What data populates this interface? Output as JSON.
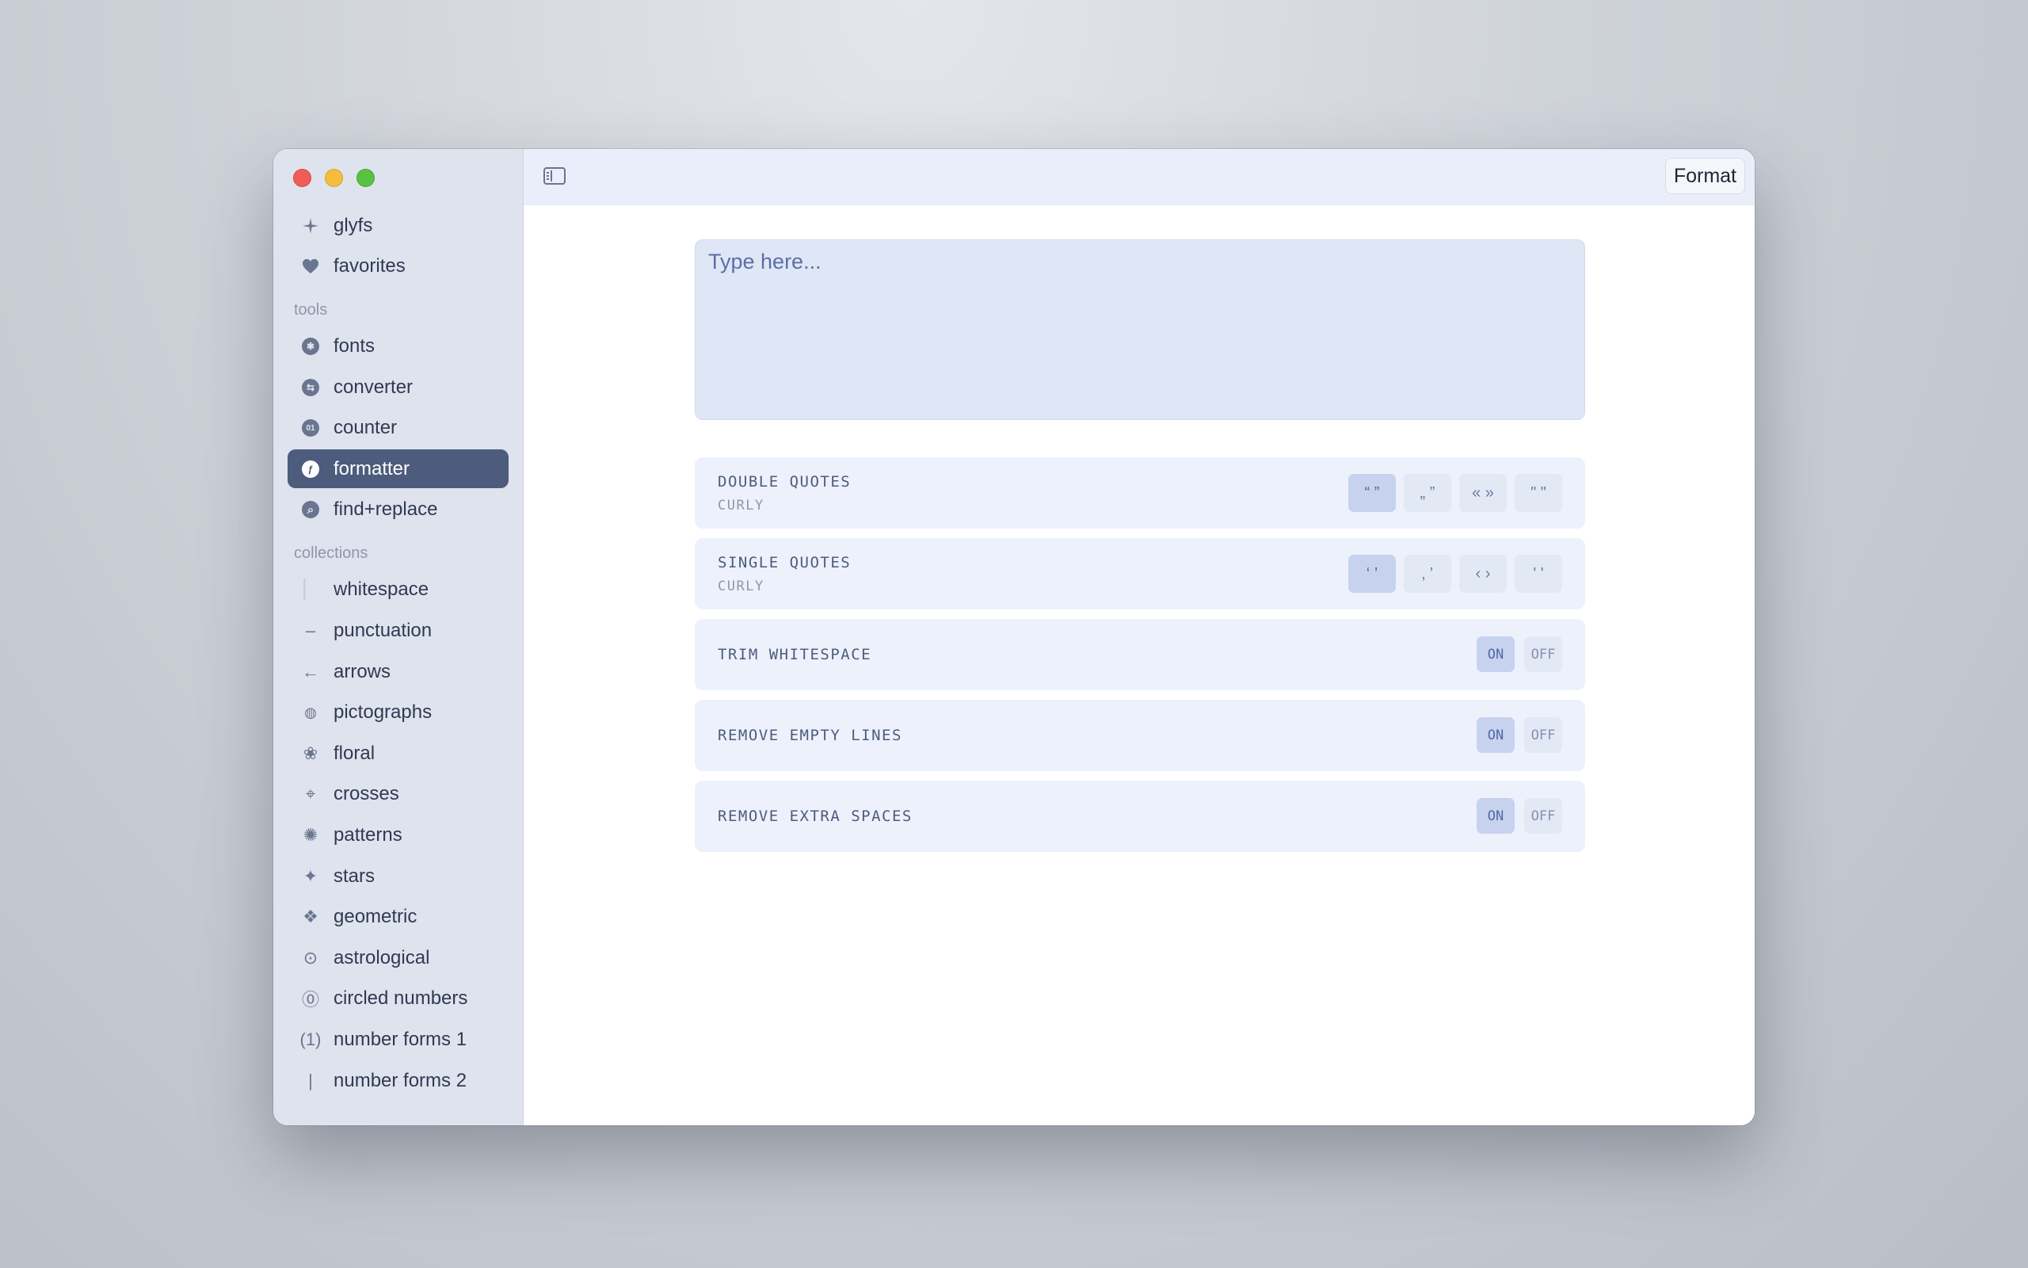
{
  "sidebar": {
    "top_items": [
      {
        "label": "glyfs",
        "icon": "sparkle-icon"
      },
      {
        "label": "favorites",
        "icon": "heart-icon"
      }
    ],
    "tools_label": "tools",
    "tools": [
      {
        "label": "fonts",
        "icon": "asterisk-circle-icon",
        "glyph": "✱"
      },
      {
        "label": "converter",
        "icon": "swap-circle-icon",
        "glyph": "⇆"
      },
      {
        "label": "counter",
        "icon": "number-circle-icon",
        "glyph": "01"
      },
      {
        "label": "formatter",
        "icon": "f-circle-icon",
        "glyph": "ƒ"
      },
      {
        "label": "find+replace",
        "icon": "magnifier-circle-icon",
        "glyph": "⌕"
      }
    ],
    "collections_label": "collections",
    "collections": [
      {
        "label": "whitespace",
        "icon": "whitespace-icon",
        "glyph": "▏"
      },
      {
        "label": "punctuation",
        "icon": "dash-icon",
        "glyph": "–"
      },
      {
        "label": "arrows",
        "icon": "arrow-left-icon",
        "glyph": "←"
      },
      {
        "label": "pictographs",
        "icon": "pictograph-icon",
        "glyph": "◍"
      },
      {
        "label": "floral",
        "icon": "flower-icon",
        "glyph": "❀"
      },
      {
        "label": "crosses",
        "icon": "cross-icon",
        "glyph": "⌖"
      },
      {
        "label": "patterns",
        "icon": "pattern-icon",
        "glyph": "✺"
      },
      {
        "label": "stars",
        "icon": "star-icon",
        "glyph": "✦"
      },
      {
        "label": "geometric",
        "icon": "geometric-icon",
        "glyph": "❖"
      },
      {
        "label": "astrological",
        "icon": "sun-symbol-icon",
        "glyph": "⊙"
      },
      {
        "label": "circled numbers",
        "icon": "circled-zero-icon",
        "glyph": "⓪"
      },
      {
        "label": "number forms 1",
        "icon": "parenthesized-one-icon",
        "glyph": "(1)"
      },
      {
        "label": "number forms 2",
        "icon": "roman-one-icon",
        "glyph": "|"
      }
    ]
  },
  "toolbar": {
    "format_label": "Format"
  },
  "editor": {
    "placeholder": "Type here..."
  },
  "options": {
    "double_quotes": {
      "title": "DOUBLE QUOTES",
      "subtitle": "CURLY",
      "choices": [
        "“ ”",
        "„ ”",
        "« »",
        "\" \""
      ],
      "selected": 0
    },
    "single_quotes": {
      "title": "SINGLE QUOTES",
      "subtitle": "CURLY",
      "choices": [
        "‘ ’",
        "‚ ’",
        "‹ ›",
        "' '"
      ],
      "selected": 0
    },
    "trim_whitespace": {
      "title": "TRIM WHITESPACE",
      "on": "ON",
      "off": "OFF",
      "value": "ON"
    },
    "remove_empty_lines": {
      "title": "REMOVE EMPTY LINES",
      "on": "ON",
      "off": "OFF",
      "value": "ON"
    },
    "remove_extra_spaces": {
      "title": "REMOVE EXTRA SPACES",
      "on": "ON",
      "off": "OFF",
      "value": "ON"
    }
  }
}
